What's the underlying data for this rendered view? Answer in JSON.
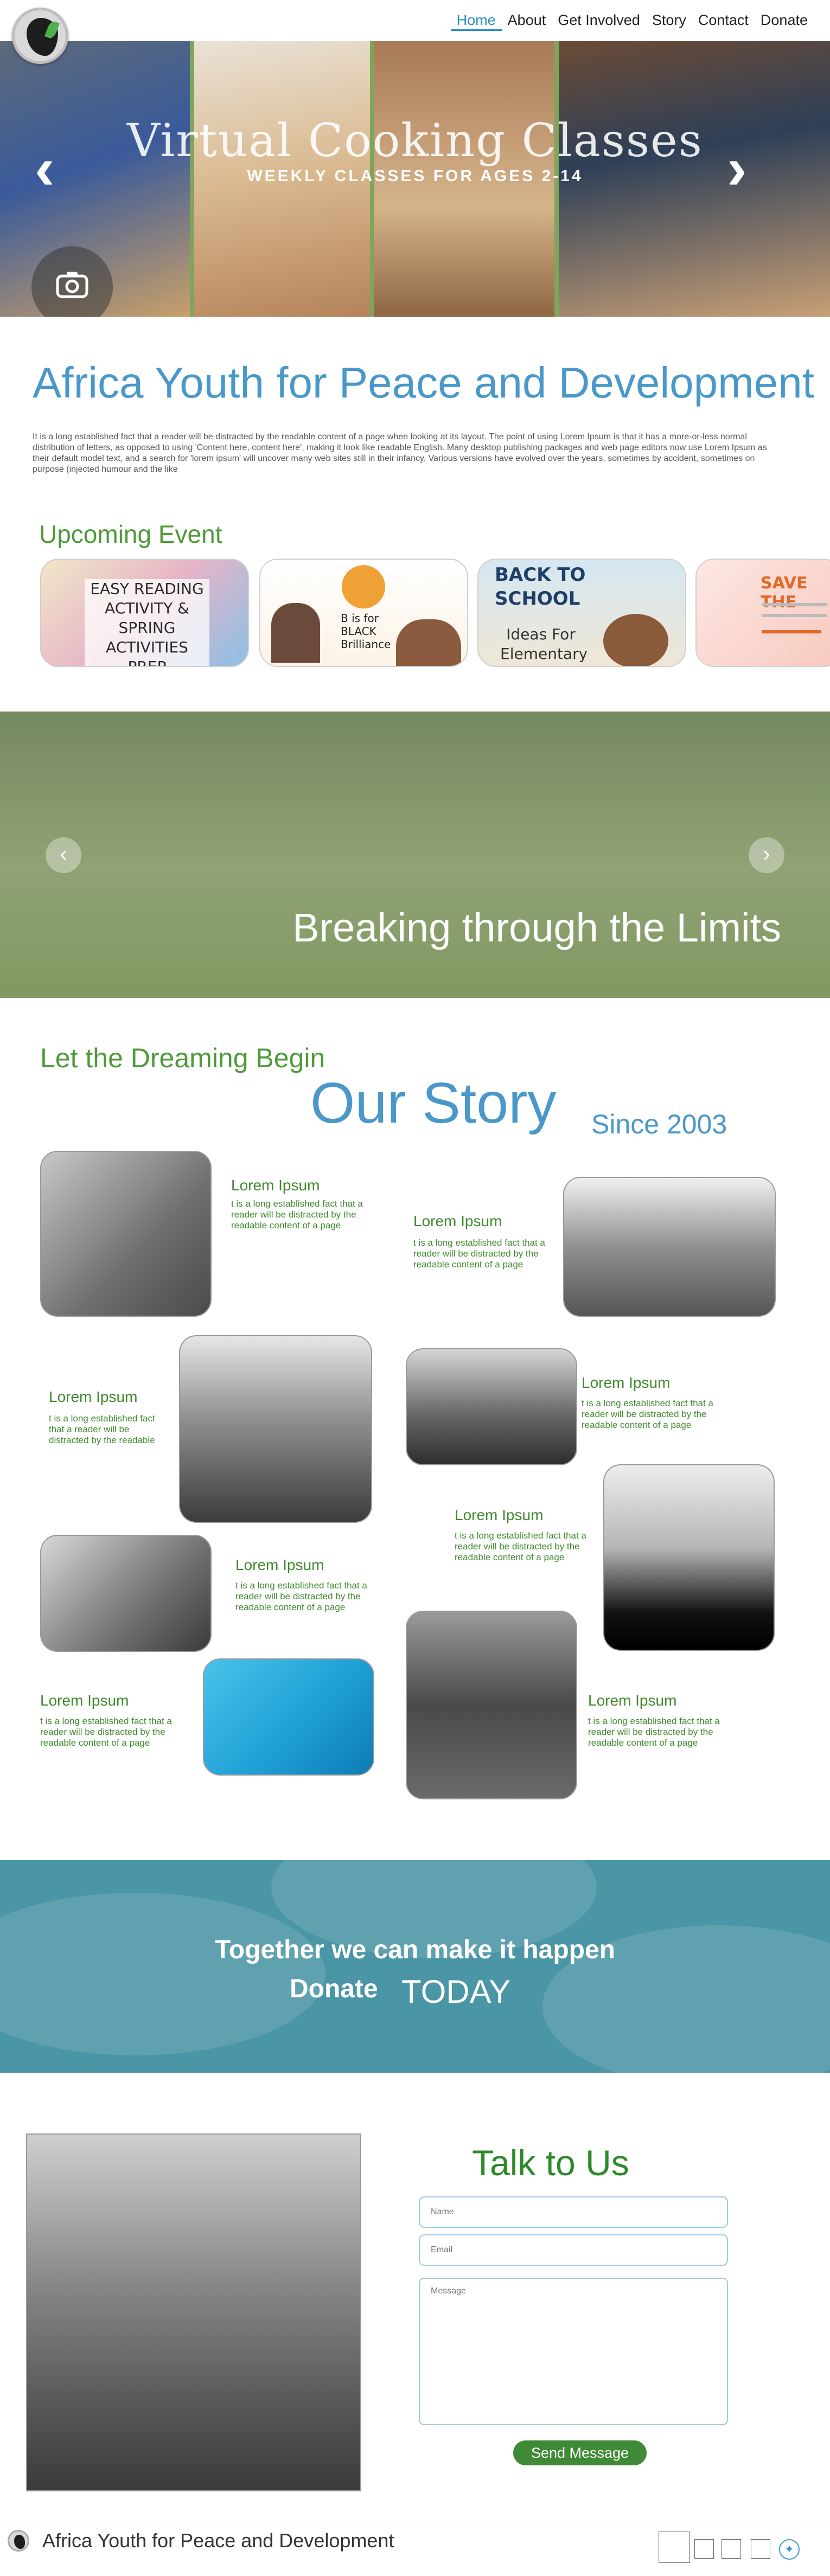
{
  "nav": {
    "home": "Home",
    "about": "About",
    "get_involved": "Get Involved",
    "story": "Story",
    "contact": "Contact",
    "donate": "Donate"
  },
  "hero": {
    "title": "Virtual Cooking Classes",
    "subtitle": "WEEKLY CLASSES FOR AGES 2-14",
    "prev_icon": "chevron-left-icon",
    "next_icon": "chevron-right-icon",
    "camera_icon": "camera-icon"
  },
  "intro": {
    "title": "Africa Youth for Peace and Development",
    "body": "It is a long established fact that a reader will be distracted by the readable content of a page when looking at its layout. The point of using Lorem Ipsum is that it has a more-or-less normal distribution of letters, as opposed to using 'Content here, content here', making it look like readable English. Many desktop publishing packages and web page editors now use Lorem Ipsum as their default model text, and a search for 'lorem ipsum' will uncover many web sites still in their infancy. Various versions have evolved over the years, sometimes by accident, sometimes on purpose (injected humour and the like"
  },
  "events": {
    "title": "Upcoming Event",
    "cards": [
      {
        "text": "EASY READING ACTIVITY & SPRING ACTIVITIES PREP"
      },
      {
        "text": "B is for BLACK Brilliance"
      },
      {
        "text": "BACK TO SCHOOL",
        "text2": "Ideas For Elementary"
      },
      {
        "text": "SAVE THE"
      }
    ]
  },
  "banner": {
    "title": "Breaking through the Limits"
  },
  "story": {
    "kicker": "Let the Dreaming Begin",
    "title": "Our Story",
    "since": "Since 2003",
    "items": [
      {
        "title": "Lorem Ipsum",
        "desc": "t is a long established fact that a reader will be distracted by the readable content of a page"
      },
      {
        "title": "Lorem Ipsum",
        "desc": "t is a long established fact that a reader will be distracted by the readable content of a page"
      },
      {
        "title": "Lorem Ipsum",
        "desc": "t is a long established fact that a reader will be distracted by the readable"
      },
      {
        "title": "Lorem Ipsum",
        "desc": "t is a long established fact that a reader will be distracted by the readable content of a page"
      },
      {
        "title": "Lorem Ipsum",
        "desc": "t is a long established fact that a reader will be distracted by the readable content of a page"
      },
      {
        "title": "Lorem Ipsum",
        "desc": "t is a long established fact that a reader will be distracted by the readable content of a page"
      },
      {
        "title": "Lorem Ipsum",
        "desc": "t is a long established fact that a reader will be distracted by the readable content of a page"
      },
      {
        "title": "Lorem Ipsum",
        "desc": "t is a long established fact that a reader will be distracted by the readable content of a page"
      }
    ]
  },
  "donate": {
    "line1": "Together we can make it happen",
    "donate_word": "Donate",
    "today_word": "TODAY"
  },
  "contact": {
    "title": "Talk to Us",
    "name_placeholder": "Name",
    "email_placeholder": "Email",
    "message_placeholder": "Message",
    "send": "Send Message"
  },
  "footer": {
    "title": "Africa Youth for Peace and Development",
    "twitter_icon": "twitter-icon"
  },
  "colors": {
    "brand_blue": "#4a98c9",
    "brand_green": "#4f9a3a",
    "donate_teal": "#4a95a6"
  }
}
